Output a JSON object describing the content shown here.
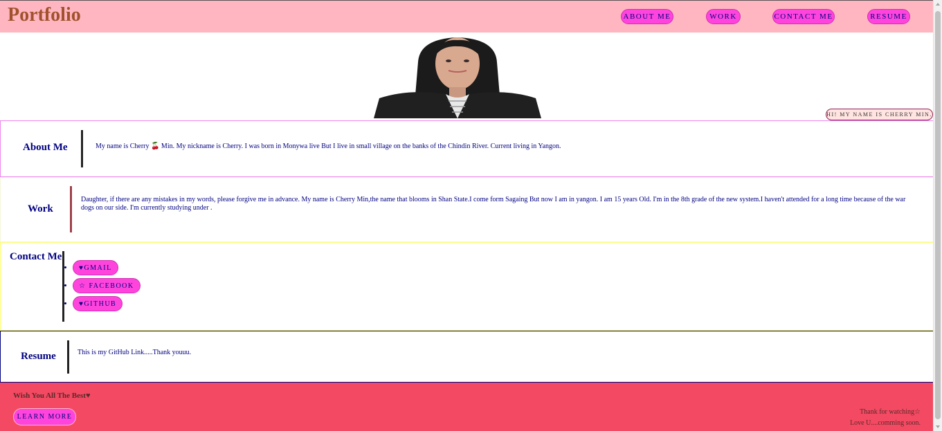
{
  "header": {
    "brand": "Portfolio",
    "nav": [
      "About Me",
      "Work",
      "Contact Me",
      "Resume"
    ]
  },
  "hero": {
    "badge": "Hi! My name is Cherry Min."
  },
  "about": {
    "title": "About Me",
    "text": "My name is Cherry 🍒 Min. My nickname is Cherry. I was born in Monywa live But I live in small village on the banks of the Chindin River. Current living in Yangon."
  },
  "work": {
    "title": "Work",
    "text": "Daughter, if there are any mistakes in my words, please forgive me in advance. My name is Cherry Min,the name that blooms in Shan State.I come form Sagaing But now I am in yangon. I am 15 years Old. I'm in the 8th grade of the new system.I haven't attended for a long time because of the war dogs on our side. I'm currently studying under ."
  },
  "contact": {
    "title": "Contact Me",
    "links": [
      "♥Gmail",
      "☆ Facebook",
      "♥Github"
    ]
  },
  "resume": {
    "title": "Resume",
    "text": "This is my GitHub Link.....Thank youuu."
  },
  "footer": {
    "heading": "Wish You All The Best♥",
    "button": "Learn more",
    "note1": "Thank for watching☆",
    "note2": "Love U....comming soon."
  },
  "colors": {
    "header_bg": "#ffb6c1",
    "brand": "#a0522d",
    "button_bg": "#ff44dd",
    "footer_bg": "#f34962",
    "text": "#000080"
  }
}
